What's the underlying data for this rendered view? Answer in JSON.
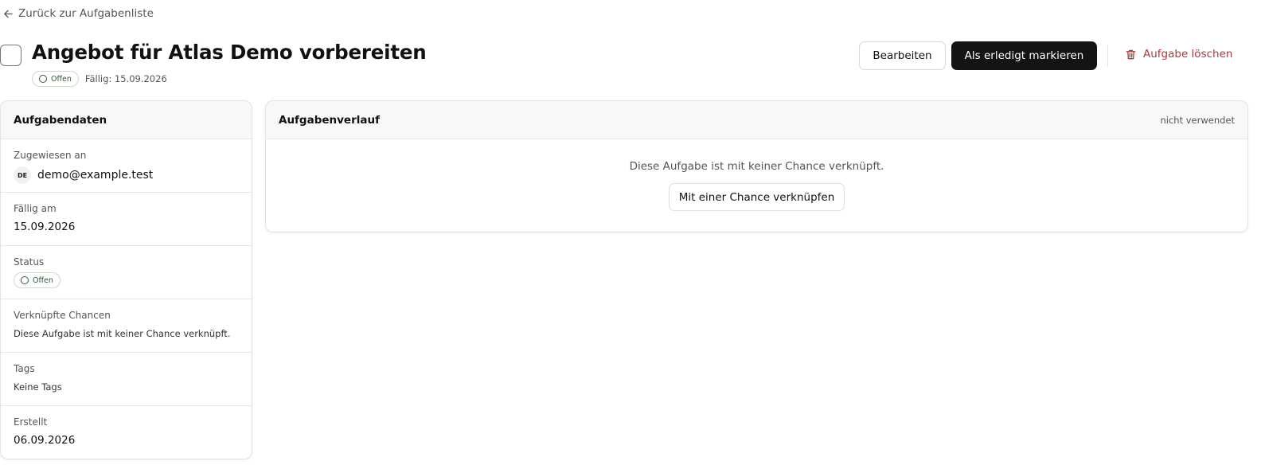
{
  "back_link": {
    "label": "Zurück zur Aufgabenliste",
    "icon": "arrow-left-icon"
  },
  "task": {
    "title": "Angebot für Atlas Demo vorbereiten",
    "status": "Offen",
    "due_line": "Fällig: 15.09.2026"
  },
  "actions": {
    "edit_label": "Bearbeiten",
    "done_label": "Als erledigt markieren",
    "delete_label": "Aufgabe löschen",
    "delete_icon": "trash-icon",
    "delete_color": "#b0373a",
    "primary_color": "#141414"
  },
  "details": {
    "title": "Aufgabendaten",
    "assigned_label": "Zugewiesen an",
    "assignee_initials": "DE",
    "assignee_email": "demo@example.test",
    "due_label": "Fällig am",
    "due_value": "15.09.2026",
    "status_label": "Status",
    "status_value": "Offen",
    "chances_label": "Verknüpfte Chancen",
    "chances_value": "Diese Aufgabe ist mit keiner Chance verknüpft.",
    "tags_label": "Tags",
    "tags_value": "Keine Tags",
    "created_label": "Erstellt",
    "created_value": "06.09.2026"
  },
  "history": {
    "title": "Aufgabenverlauf",
    "note": "nicht verwendet",
    "empty_text": "Diese Aufgabe ist mit keiner Chance verknüpft.",
    "link_button": "Mit einer Chance verknüpfen"
  },
  "status_color": "#2f5a37"
}
